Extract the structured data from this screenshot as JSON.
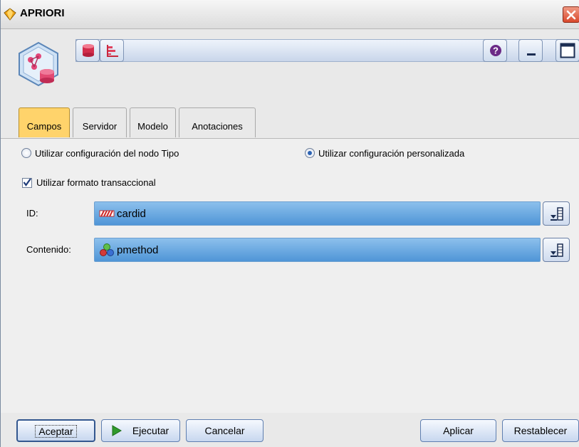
{
  "window": {
    "title": "APRIORI",
    "icon": "diamond-node-icon",
    "close_icon": "close-icon"
  },
  "toolbar": {
    "node_icon": "apriori-node-icon",
    "buttons": [
      {
        "name": "database-icon"
      },
      {
        "name": "chart-icon"
      }
    ],
    "help_icon": "help-icon",
    "minimize_icon": "minimize-icon",
    "maximize_icon": "maximize-icon"
  },
  "tabs": [
    {
      "label": "Campos",
      "active": true
    },
    {
      "label": "Servidor",
      "active": false
    },
    {
      "label": "Modelo",
      "active": false
    },
    {
      "label": "Anotaciones",
      "active": false
    }
  ],
  "fields_panel": {
    "radio_type_node": "Utilizar configuración del nodo Tipo",
    "radio_custom": "Utilizar configuración personalizada",
    "custom_selected": true,
    "checkbox_transactional": "Utilizar formato transaccional",
    "transactional_checked": true,
    "id_label": "ID:",
    "id_value": "cardid",
    "content_label": "Contenido:",
    "content_value": "pmethod"
  },
  "buttons": {
    "accept": "Aceptar",
    "run": "Ejecutar",
    "cancel": "Cancelar",
    "apply": "Aplicar",
    "reset": "Restablecer"
  },
  "colors": {
    "active_tab": "#ffd36b",
    "field_fill": "#6aaae2",
    "close": "#d9482c"
  }
}
